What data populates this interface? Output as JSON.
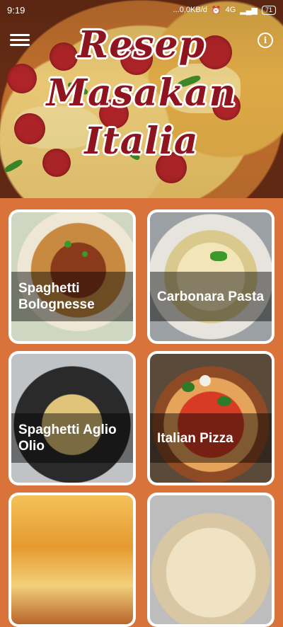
{
  "status_bar": {
    "time": "9:19",
    "network": "...0,0KB/d",
    "signal": "4G",
    "battery": "71"
  },
  "header": {
    "title_line1": "Resep",
    "title_line2": "Masakan",
    "title_line3": "Italia",
    "menu_icon": "hamburger-menu-icon",
    "info_icon": "info-icon",
    "title_color": "#8e1420"
  },
  "recipes": [
    {
      "label": "Spaghetti Bolognesse"
    },
    {
      "label": "Carbonara Pasta"
    },
    {
      "label": "Spaghetti Aglio Olio"
    },
    {
      "label": "Italian Pizza"
    },
    {
      "label": ""
    },
    {
      "label": ""
    }
  ],
  "colors": {
    "background": "#d9733a",
    "card": "#ffffff"
  }
}
